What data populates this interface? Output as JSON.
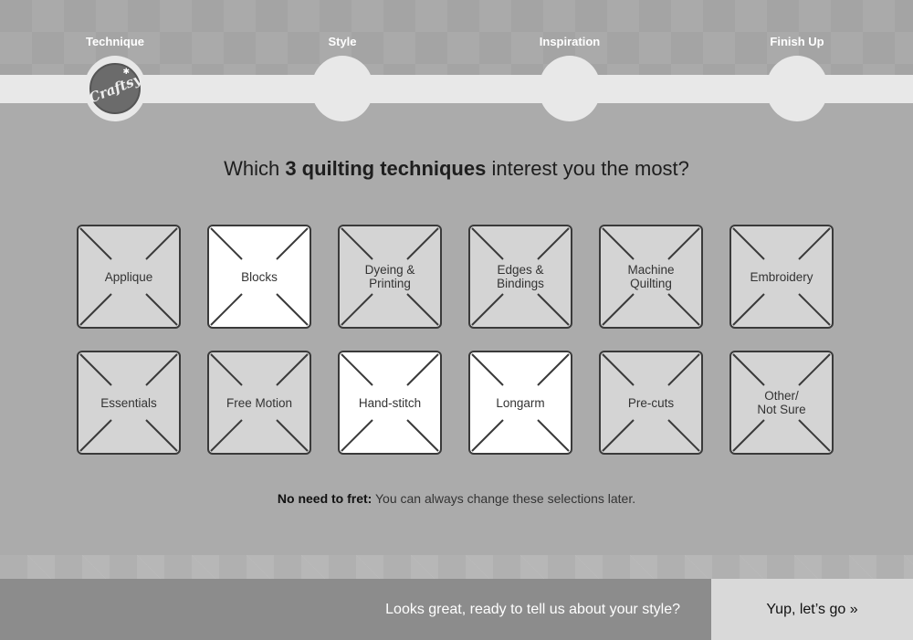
{
  "steps": [
    {
      "label": "Technique",
      "active": true
    },
    {
      "label": "Style",
      "active": false
    },
    {
      "label": "Inspiration",
      "active": false
    },
    {
      "label": "Finish Up",
      "active": false
    }
  ],
  "logo": {
    "text": "Craftsy"
  },
  "question": {
    "prefix": "Which ",
    "emphasis": "3 quilting techniques",
    "suffix": " interest you the most?"
  },
  "tiles": [
    {
      "label": "Applique",
      "selected": false
    },
    {
      "label": "Blocks",
      "selected": true
    },
    {
      "label": "Dyeing &\nPrinting",
      "selected": false
    },
    {
      "label": "Edges &\nBindings",
      "selected": false
    },
    {
      "label": "Machine\nQuilting",
      "selected": false
    },
    {
      "label": "Embroidery",
      "selected": false
    },
    {
      "label": "Essentials",
      "selected": false
    },
    {
      "label": "Free Motion",
      "selected": false
    },
    {
      "label": "Hand-stitch",
      "selected": true
    },
    {
      "label": "Longarm",
      "selected": true
    },
    {
      "label": "Pre-cuts",
      "selected": false
    },
    {
      "label": "Other/\nNot Sure",
      "selected": false
    }
  ],
  "note": {
    "bold": "No need to fret:",
    "text": " You can always change these selections later."
  },
  "footer": {
    "message": "Looks great, ready to tell us about your style?",
    "cta": "Yup, let’s go »"
  }
}
